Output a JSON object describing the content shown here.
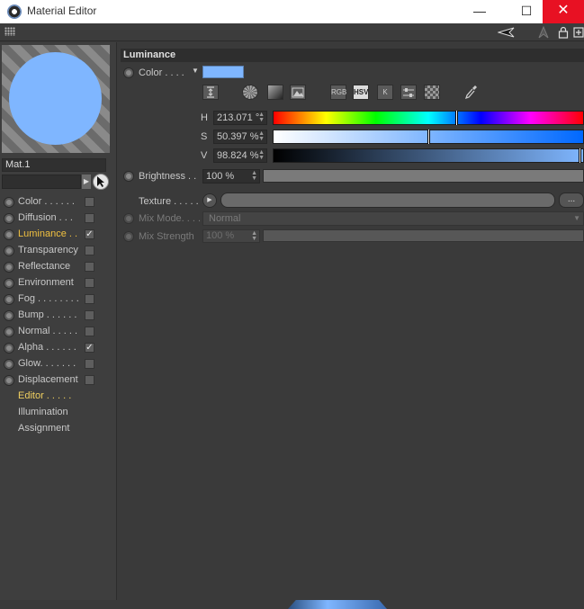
{
  "window": {
    "title": "Material Editor",
    "controls": {
      "minimize": "—",
      "maximize": "☐",
      "close": "✕"
    }
  },
  "toolbar": {
    "icons": [
      "grip-icon",
      "back-arrow-icon",
      "forward-arrow-icon",
      "lock-icon",
      "new-panel-icon"
    ]
  },
  "material": {
    "name": "Mat.1",
    "preview_color": "#7fb6ff"
  },
  "channels": [
    {
      "label": "Color . . . . . .",
      "checked": false,
      "active": false,
      "has_radio": true,
      "has_check": true
    },
    {
      "label": "Diffusion . . .",
      "checked": false,
      "active": false,
      "has_radio": true,
      "has_check": true
    },
    {
      "label": "Luminance . .",
      "checked": true,
      "active": true,
      "has_radio": true,
      "has_check": true
    },
    {
      "label": "Transparency",
      "checked": false,
      "active": false,
      "has_radio": true,
      "has_check": true
    },
    {
      "label": "Reflectance",
      "checked": false,
      "active": false,
      "has_radio": true,
      "has_check": true
    },
    {
      "label": "Environment",
      "checked": false,
      "active": false,
      "has_radio": true,
      "has_check": true
    },
    {
      "label": "Fog . . . . . . . .",
      "checked": false,
      "active": false,
      "has_radio": true,
      "has_check": true
    },
    {
      "label": "Bump . . . . . .",
      "checked": false,
      "active": false,
      "has_radio": true,
      "has_check": true
    },
    {
      "label": "Normal . . . . .",
      "checked": false,
      "active": false,
      "has_radio": true,
      "has_check": true
    },
    {
      "label": "Alpha . . . . . .",
      "checked": true,
      "active": false,
      "has_radio": true,
      "has_check": true
    },
    {
      "label": "Glow. . . . . . .",
      "checked": false,
      "active": false,
      "has_radio": true,
      "has_check": true
    },
    {
      "label": "Displacement",
      "checked": false,
      "active": false,
      "has_radio": true,
      "has_check": true
    }
  ],
  "extra_pages": [
    {
      "label": "Editor . . . . .",
      "active": true
    },
    {
      "label": "Illumination",
      "active": false
    },
    {
      "label": "Assignment",
      "active": false
    }
  ],
  "section": {
    "title": "Luminance",
    "color_label": "Color . . . .",
    "color_value": "#7fb6ff",
    "modes": [
      "RGB",
      "HSV",
      "K"
    ],
    "h": {
      "label": "H",
      "value": "213.071 °",
      "position": 0.59
    },
    "s": {
      "label": "S",
      "value": "50.397 %",
      "position": 0.5
    },
    "v": {
      "label": "V",
      "value": "98.824 %",
      "position": 0.988
    },
    "brightness_label": "Brightness . .",
    "brightness_value": "100 %",
    "texture_label": "Texture . . . . .",
    "texture_more": "...",
    "mixmode_label": "Mix Mode. . . .",
    "mixmode_value": "Normal",
    "mixstrength_label": "Mix Strength",
    "mixstrength_value": "100 %"
  }
}
